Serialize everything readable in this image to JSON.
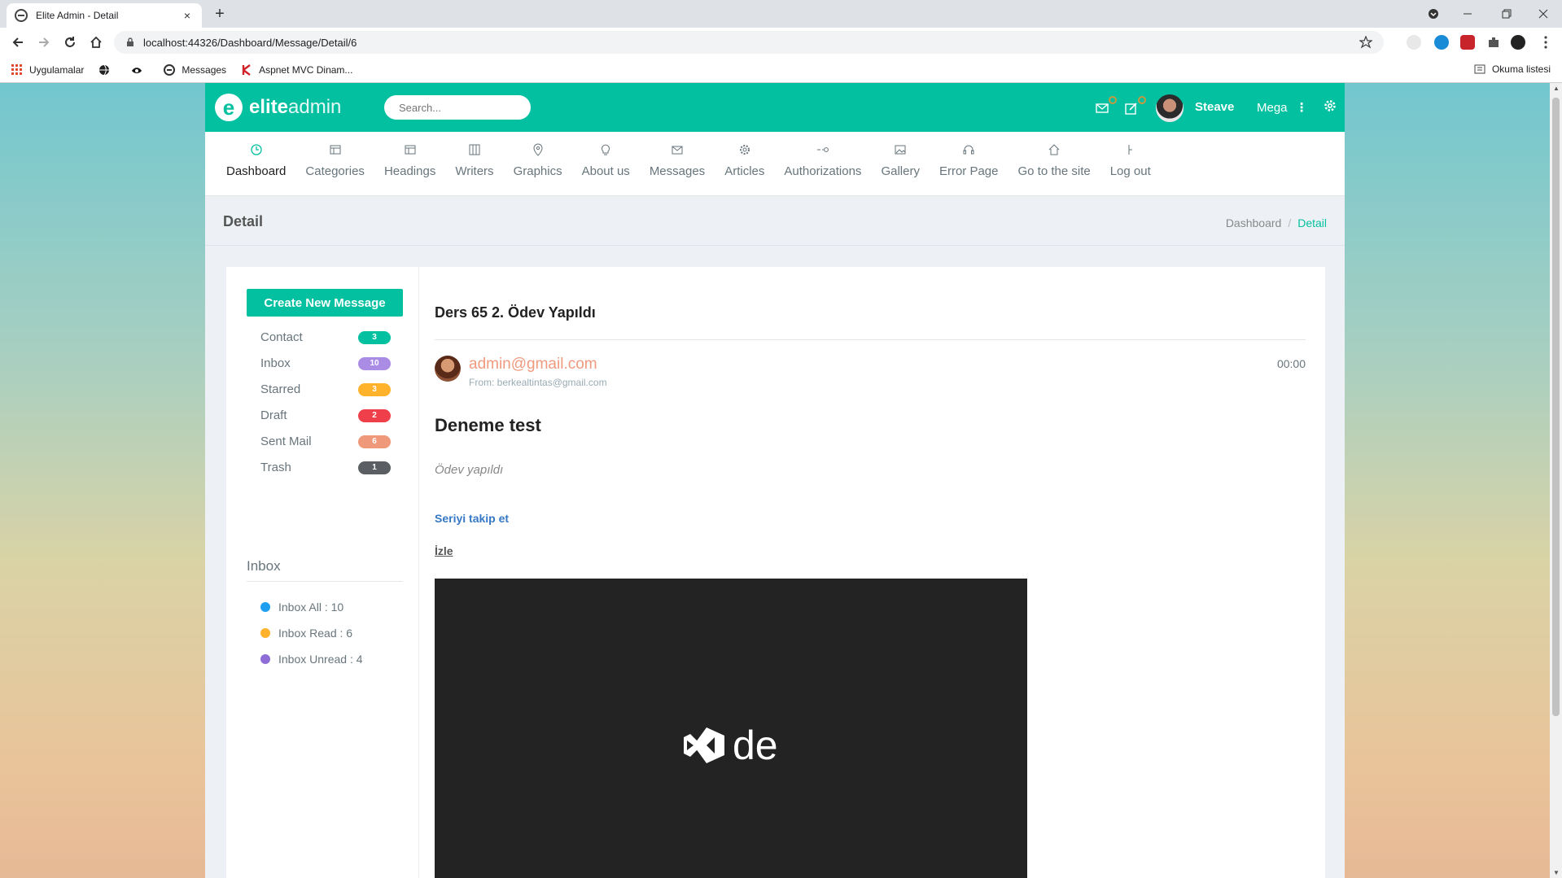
{
  "browser": {
    "tab_title": "Elite Admin - Detail",
    "tab_close": "×",
    "new_tab": "+",
    "url": "localhost:44326/Dashboard/Message/Detail/6",
    "bookmarks": [
      "Uygulamalar",
      "Messages",
      "Aspnet MVC Dinam..."
    ],
    "reading_list": "Okuma listesi"
  },
  "header": {
    "logo_bold": "elite",
    "logo_light": "admin",
    "search_placeholder": "Search...",
    "user_name": "Steave",
    "mega_label": "Mega"
  },
  "nav": [
    {
      "label": "Dashboard",
      "icon": "clock-icon"
    },
    {
      "label": "Categories",
      "icon": "layout-icon"
    },
    {
      "label": "Headings",
      "icon": "layout-icon"
    },
    {
      "label": "Writers",
      "icon": "columns-icon"
    },
    {
      "label": "Graphics",
      "icon": "map-pin-icon"
    },
    {
      "label": "About us",
      "icon": "bulb-icon"
    },
    {
      "label": "Messages",
      "icon": "mail-icon"
    },
    {
      "label": "Articles",
      "icon": "gear-icon"
    },
    {
      "label": "Authorizations",
      "icon": "key-icon"
    },
    {
      "label": "Gallery",
      "icon": "image-icon"
    },
    {
      "label": "Error Page",
      "icon": "headset-icon"
    },
    {
      "label": "Go to the site",
      "icon": "home-icon"
    },
    {
      "label": "Log out",
      "icon": "logout-icon"
    }
  ],
  "page": {
    "title": "Detail",
    "breadcrumb": [
      "Dashboard",
      "/",
      "Detail"
    ]
  },
  "sidebar": {
    "create_button": "Create New Message",
    "folders": [
      {
        "label": "Contact",
        "count": "3",
        "color": "#03c0a0"
      },
      {
        "label": "Inbox",
        "count": "10",
        "color": "#ab8ce4"
      },
      {
        "label": "Starred",
        "count": "3",
        "color": "#ffb22b"
      },
      {
        "label": "Draft",
        "count": "2",
        "color": "#ef3f4a"
      },
      {
        "label": "Sent Mail",
        "count": "6",
        "color": "#f0987a"
      },
      {
        "label": "Trash",
        "count": "1",
        "color": "#5b5f63"
      }
    ],
    "inbox_heading": "Inbox",
    "inbox_stats": [
      {
        "label": "Inbox All : 10",
        "color": "#1e9ff2"
      },
      {
        "label": "Inbox Read : 6",
        "color": "#ffb22b"
      },
      {
        "label": "Inbox Unread : 4",
        "color": "#8e6ed6"
      }
    ]
  },
  "message": {
    "subject": "Ders 65 2. Ödev Yapıldı",
    "sender": "admin@gmail.com",
    "from": "From: berkealtintas@gmail.com",
    "time": "00:00",
    "title": "Deneme test",
    "body": "Ödev yapıldı",
    "series_link": "Seriyi takip et",
    "watch_link": "İzle",
    "video_logo_text": "de"
  },
  "colors": {
    "primary": "#03c0a0"
  }
}
